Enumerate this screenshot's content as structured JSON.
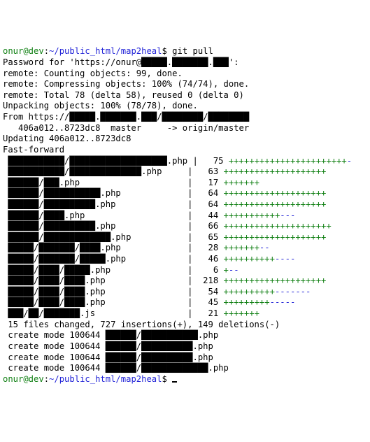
{
  "prompt1_user": "onur@dev",
  "prompt1_path": "~/public_html/map2heal",
  "prompt1_cmd": "git pull",
  "pwd_line": "Password for 'https://onur@█████.███████.███':",
  "remote_count": "remote: Counting objects: 99, done.",
  "remote_compress": "remote: Compressing objects: 100% (74/74), done.",
  "remote_total": "remote: Total 78 (delta 58), reused 0 (delta 0)",
  "unpack": "Unpacking objects: 100% (78/78), done.",
  "from": "From https://█████.███████.███/████████/████████",
  "branch_line": "   406a012..8723dc8  master     -> origin/master",
  "updating": "Updating 406a012..8723dc8",
  "ff": "Fast-forward",
  "files": [
    {
      "name": " ███████████/███████████████████.php",
      "pad": " |   75 ",
      "diff": "+++++++++++++++++++++++-"
    },
    {
      "name": " ███████████/██████████████.php    ",
      "pad": " |   63 ",
      "diff": "++++++++++++++++++++"
    },
    {
      "name": " ██████/███.php                    ",
      "pad": " |   17 ",
      "diff": "+++++++"
    },
    {
      "name": " ██████/███████████.php            ",
      "pad": " |   64 ",
      "diff": "++++++++++++++++++++"
    },
    {
      "name": " ██████/██████████.php             ",
      "pad": " |   64 ",
      "diff": "++++++++++++++++++++"
    },
    {
      "name": " ██████/████.php                   ",
      "pad": " |   44 ",
      "diff": "+++++++++++---"
    },
    {
      "name": " ██████/██████████.php             ",
      "pad": " |   66 ",
      "diff": "+++++++++++++++++++++"
    },
    {
      "name": " ██████/█████████████.php          ",
      "pad": " |   65 ",
      "diff": "++++++++++++++++++++"
    },
    {
      "name": " █████/███████/████.php            ",
      "pad": " |   28 ",
      "diff": "+++++++--"
    },
    {
      "name": " █████/███████/█████.php           ",
      "pad": " |   46 ",
      "diff": "++++++++++----"
    },
    {
      "name": " █████/████/█████.php              ",
      "pad": " |    6 ",
      "diff": "+--"
    },
    {
      "name": " █████/████/████.php               ",
      "pad": " |  218 ",
      "diff": "++++++++++++++++++++"
    },
    {
      "name": " █████/████/████.php               ",
      "pad": " |   54 ",
      "diff": "++++++++++-------"
    },
    {
      "name": " █████/████/████.php               ",
      "pad": " |   45 ",
      "diff": "+++++++++-----"
    },
    {
      "name": " ███/██/███████.js                 ",
      "pad": " |   21 ",
      "diff": "+++++++"
    }
  ],
  "summary": " 15 files changed, 727 insertions(+), 149 deletions(-)",
  "creates": [
    " create mode 100644 ██████/███████████.php",
    " create mode 100644 ██████/██████████.php",
    " create mode 100644 ██████/██████████.php",
    " create mode 100644 ██████/█████████████.php"
  ],
  "prompt2_user": "onur@dev",
  "prompt2_path": "~/public_html/map2heal"
}
